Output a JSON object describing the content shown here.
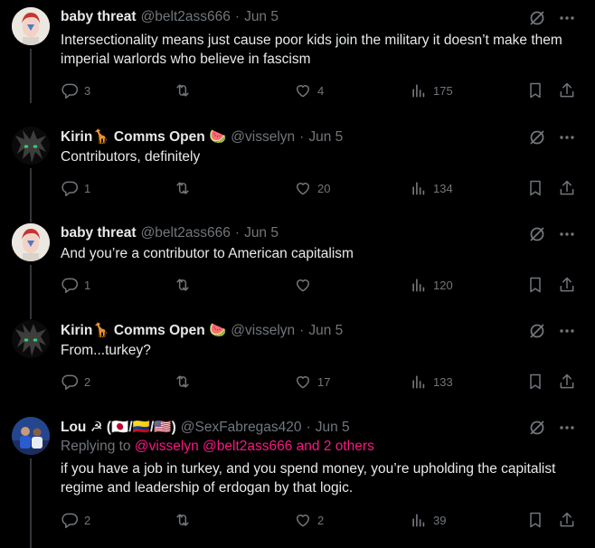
{
  "tweets": [
    {
      "name": "baby threat",
      "handle": "@belt2ass666",
      "sep": "·",
      "date": "Jun 5",
      "text": "Intersectionality means just cause poor kids join the military it doesn’t make them imperial warlords who believe in fascism",
      "replies": "3",
      "reposts": "",
      "likes": "4",
      "views": "175"
    },
    {
      "name": "Kirin🦒 Comms Open 🍉",
      "handle": "@visselyn",
      "sep": "·",
      "date": "Jun 5",
      "text": "Contributors, definitely",
      "replies": "1",
      "reposts": "",
      "likes": "20",
      "views": "134"
    },
    {
      "name": "baby threat",
      "handle": "@belt2ass666",
      "sep": "·",
      "date": "Jun 5",
      "text": "And you’re a contributor to American capitalism",
      "replies": "1",
      "reposts": "",
      "likes": "",
      "views": "120"
    },
    {
      "name": "Kirin🦒 Comms Open 🍉",
      "handle": "@visselyn",
      "sep": "·",
      "date": "Jun 5",
      "text": "From...turkey?",
      "replies": "2",
      "reposts": "",
      "likes": "17",
      "views": "133"
    },
    {
      "name": "Lou ☭ (🇯🇵/🇨🇴/🇺🇸)",
      "handle": "@SexFabregas420",
      "sep": "·",
      "date": "Jun 5",
      "reply_prefix": "Replying to",
      "reply_targets": "@visselyn @belt2ass666 and 2 others",
      "text": "if you have a job in turkey, and you spend money, you’re upholding the capitalist regime and leadership of erdogan by that logic.",
      "replies": "2",
      "reposts": "",
      "likes": "2",
      "views": "39"
    }
  ],
  "icons": {
    "grok": "grok-icon",
    "more": "more-icon",
    "reply": "reply-icon",
    "repost": "repost-icon",
    "like": "like-icon",
    "views": "views-icon",
    "bookmark": "bookmark-icon",
    "share": "share-icon"
  },
  "colors": {
    "background": "#000000",
    "text": "#e7e9ea",
    "muted": "#71767b",
    "link": "#f91880",
    "thread_line": "#333639"
  }
}
